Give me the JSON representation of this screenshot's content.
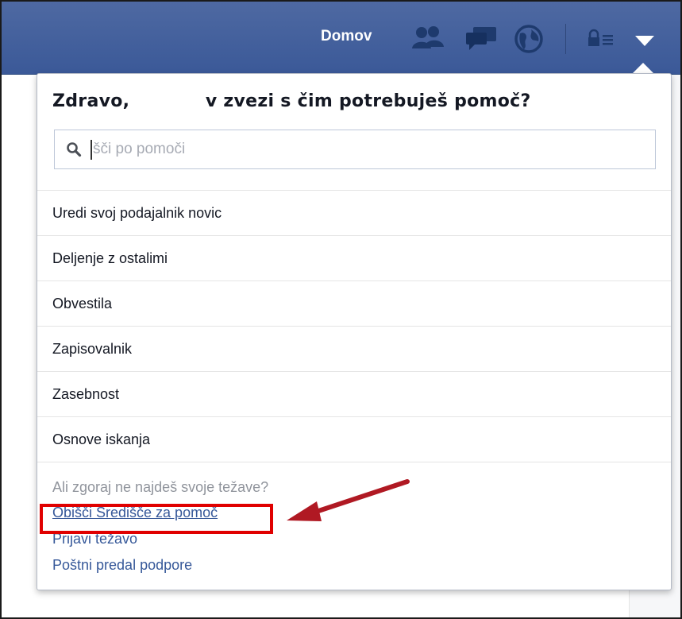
{
  "topbar": {
    "home_label": "Domov",
    "icons": [
      "friends-icon",
      "messages-icon",
      "notifications-globe-icon",
      "privacy-lock-icon",
      "account-menu-arrow-icon"
    ],
    "brand_color": "#3b5998"
  },
  "help_panel": {
    "greeting": "Zdravo,            v zvezi s čim potrebuješ pomoč?",
    "search": {
      "placeholder": "šči po pomoči",
      "value": ""
    },
    "topics": [
      "Uredi svoj podajalnik novic",
      "Deljenje z ostalimi",
      "Obvestila",
      "Zapisovalnik",
      "Zasebnost",
      "Osnove iskanja"
    ],
    "footer": {
      "prompt": "Ali zgoraj ne najdeš svoje težave?",
      "visit_help_center": "Obišči Središče za pomoč",
      "report_problem": "Prijavi težavo",
      "support_inbox": "Poštni predal podpore"
    }
  },
  "annotation": {
    "highlight_color": "#e00000",
    "arrow_color": "#b01923"
  }
}
